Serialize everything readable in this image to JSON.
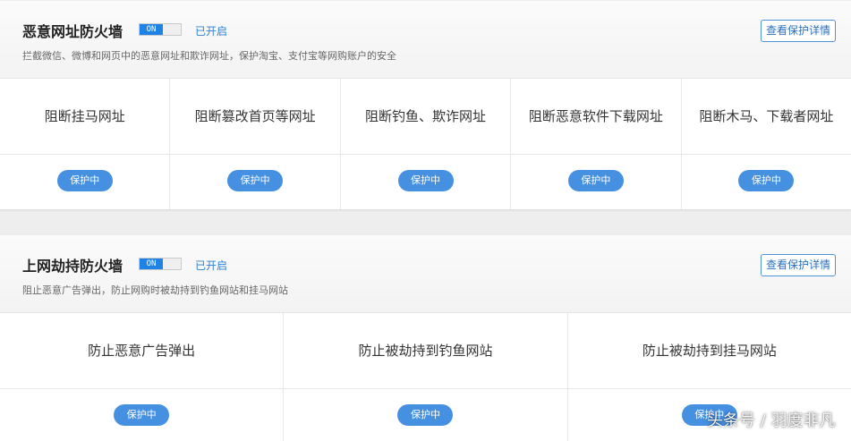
{
  "panels": [
    {
      "title": "恶意网址防火墙",
      "toggle": "ON",
      "status": "已开启",
      "description": "拦截微信、微博和网页中的恶意网址和欺诈网址，保护淘宝、支付宝等网购账户的安全",
      "details_button": "查看保护详情",
      "items": [
        {
          "label": "阻断挂马网址",
          "badge": "保护中"
        },
        {
          "label": "阻断篡改首页等网址",
          "badge": "保护中"
        },
        {
          "label": "阻断钓鱼、欺诈网址",
          "badge": "保护中"
        },
        {
          "label": "阻断恶意软件下载网址",
          "badge": "保护中"
        },
        {
          "label": "阻断木马、下载者网址",
          "badge": "保护中"
        }
      ]
    },
    {
      "title": "上网劫持防火墙",
      "toggle": "ON",
      "status": "已开启",
      "description": "阻止恶意广告弹出，防止网购时被劫持到钓鱼网站和挂马网站",
      "details_button": "查看保护详情",
      "items": [
        {
          "label": "防止恶意广告弹出",
          "badge": "保护中"
        },
        {
          "label": "防止被劫持到钓鱼网站",
          "badge": "保护中"
        },
        {
          "label": "防止被劫持到挂马网站",
          "badge": "保护中"
        }
      ]
    }
  ],
  "watermark": "头条号 / 羽度非凡",
  "colors": {
    "accent": "#1f83e5",
    "badge": "#4690e2",
    "link": "#2d7fd6"
  }
}
